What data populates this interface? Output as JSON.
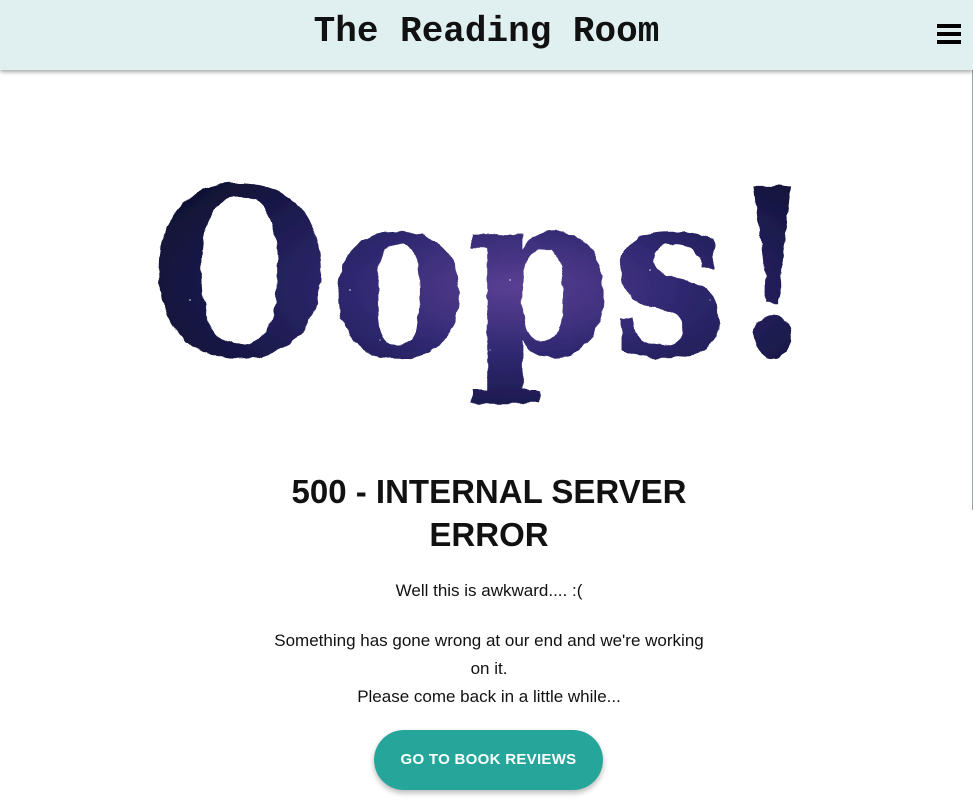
{
  "header": {
    "brand": "The Reading Room",
    "menu_icon": "hamburger-menu-icon"
  },
  "hero": {
    "text": "Oops!",
    "fill_colors": [
      "#0b0f26",
      "#1a1650",
      "#3b2a7a",
      "#6a4a9a"
    ]
  },
  "error": {
    "title": "500 - INTERNAL SERVER ERROR",
    "subtitle": "Well this is awkward.... :(",
    "message_line1": "Something has gone wrong at our end and we're working on it.",
    "message_line2": "Please come back in a little while..."
  },
  "cta": {
    "label": "GO TO BOOK REVIEWS",
    "color": "#26a69a"
  }
}
